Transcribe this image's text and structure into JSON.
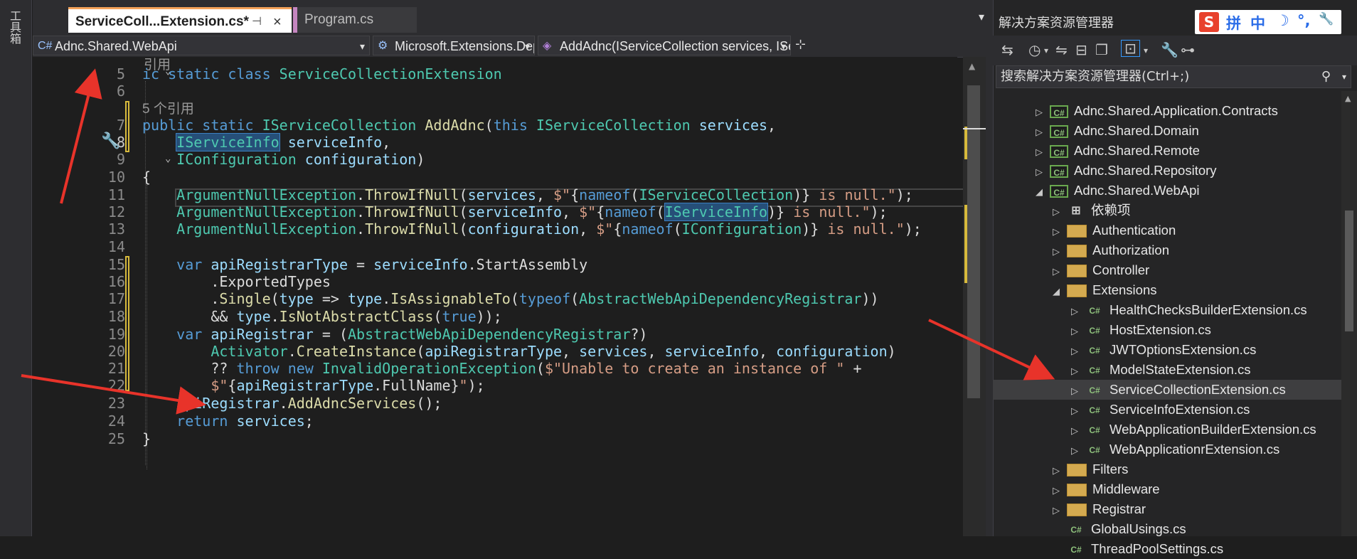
{
  "toolstrip": {
    "label": "工具箱"
  },
  "tabs": {
    "active": {
      "label": "ServiceColl...Extension.cs*",
      "pin": "⊣",
      "close": "×"
    },
    "other": {
      "label": "Program.cs"
    }
  },
  "navbar": {
    "project": "Adnc.Shared.WebApi",
    "type": "Microsoft.Extensions.Depe",
    "member": "AddAdnc(IServiceCollection services, IServic"
  },
  "code": {
    "line_numbers": [
      "5",
      "6",
      "7",
      "8",
      "9",
      "10",
      "11",
      "12",
      "13",
      "14",
      "15",
      "16",
      "17",
      "18",
      "19",
      "20",
      "21",
      "22",
      "23",
      "24",
      "25"
    ],
    "refs_top": "引用",
    "refs_method": "5 个引用"
  },
  "solution_explorer": {
    "title": "解决方案资源管理器",
    "ime": {
      "g1": "拼",
      "g2": "中",
      "g3": "☽",
      "g4": "°,",
      "g5": "🔧"
    },
    "search_placeholder": "搜索解决方案资源管理器(Ctrl+;)",
    "items": [
      {
        "label": "Adnc.Shared.Application.Contracts",
        "icon": "project-icon"
      },
      {
        "label": "Adnc.Shared.Domain",
        "icon": "project-icon"
      },
      {
        "label": "Adnc.Shared.Remote",
        "icon": "project-icon"
      },
      {
        "label": "Adnc.Shared.Repository",
        "icon": "project-icon"
      },
      {
        "label": "Adnc.Shared.WebApi",
        "icon": "project-icon"
      },
      {
        "label": "依赖项",
        "icon": "dependencies-icon"
      },
      {
        "label": "Authentication",
        "icon": "folder-icon"
      },
      {
        "label": "Authorization",
        "icon": "folder-icon"
      },
      {
        "label": "Controller",
        "icon": "folder-icon"
      },
      {
        "label": "Extensions",
        "icon": "folder-icon"
      },
      {
        "label": "HealthChecksBuilderExtension.cs",
        "icon": "csharp-file-icon"
      },
      {
        "label": "HostExtension.cs",
        "icon": "csharp-file-icon"
      },
      {
        "label": "JWTOptionsExtension.cs",
        "icon": "csharp-file-icon"
      },
      {
        "label": "ModelStateExtension.cs",
        "icon": "csharp-file-icon"
      },
      {
        "label": "ServiceCollectionExtension.cs",
        "icon": "csharp-file-icon"
      },
      {
        "label": "ServiceInfoExtension.cs",
        "icon": "csharp-file-icon"
      },
      {
        "label": "WebApplicationBuilderExtension.cs",
        "icon": "csharp-file-icon"
      },
      {
        "label": "WebApplicationrExtension.cs",
        "icon": "csharp-file-icon"
      },
      {
        "label": "Filters",
        "icon": "folder-icon"
      },
      {
        "label": "Middleware",
        "icon": "folder-icon"
      },
      {
        "label": "Registrar",
        "icon": "folder-icon"
      },
      {
        "label": "GlobalUsings.cs",
        "icon": "csharp-file-icon"
      },
      {
        "label": "ThreadPoolSettings.cs",
        "icon": "csharp-file-icon"
      }
    ]
  },
  "colors": {
    "accent_tab": "#f4a259",
    "keyword": "#569cd6",
    "type": "#4ec9b0",
    "method": "#dcdcaa",
    "variable": "#9cdcfe",
    "string": "#d69d85",
    "arrow": "#e8332a"
  }
}
